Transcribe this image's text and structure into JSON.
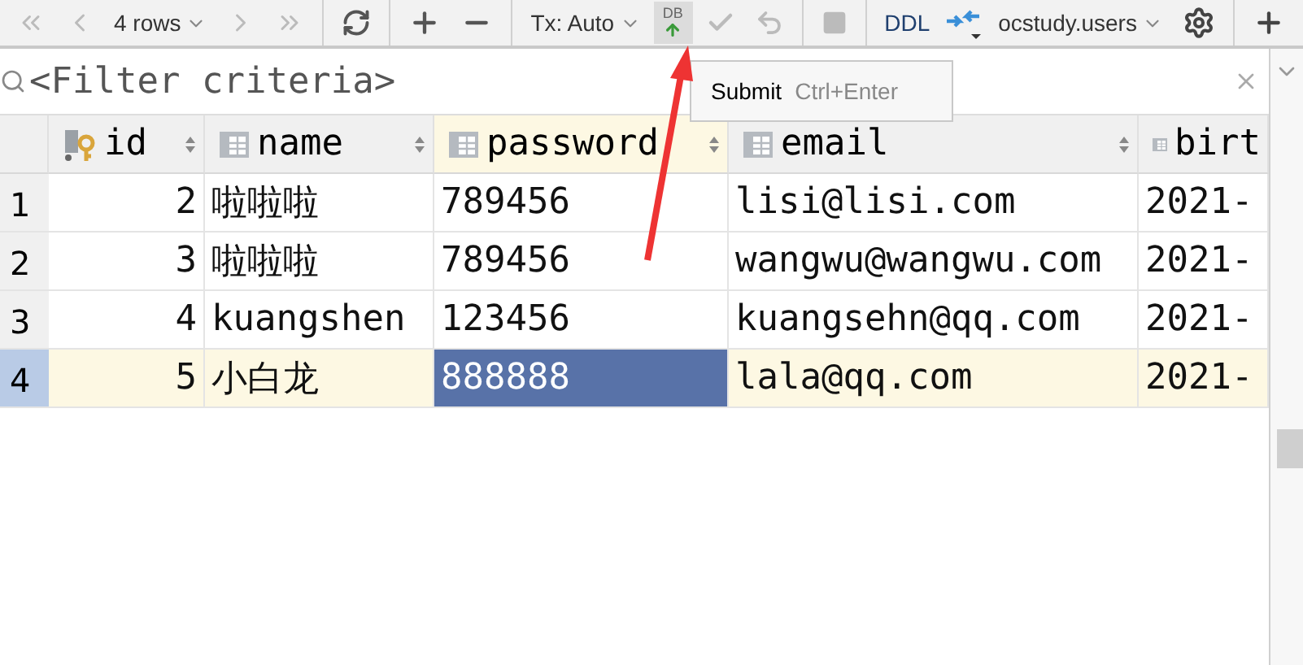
{
  "toolbar": {
    "rows_label": "4 rows",
    "tx_label": "Tx: Auto",
    "submit_label": "DB",
    "ddl_label": "DDL",
    "table_name": "ocstudy.users"
  },
  "tooltip": {
    "label": "Submit",
    "shortcut": "Ctrl+Enter"
  },
  "filter": {
    "placeholder": "<Filter criteria>"
  },
  "table": {
    "columns": [
      {
        "label": "id",
        "kind": "key",
        "selected": false
      },
      {
        "label": "name",
        "kind": "column",
        "selected": false
      },
      {
        "label": "password",
        "kind": "column",
        "selected": true
      },
      {
        "label": "email",
        "kind": "column",
        "selected": false
      },
      {
        "label": "birt",
        "kind": "column",
        "selected": false
      }
    ],
    "rows": [
      {
        "number": "1",
        "selected": false,
        "cells": [
          {
            "text": "2",
            "selected": false
          },
          {
            "text": "啦啦啦",
            "selected": false
          },
          {
            "text": "789456",
            "selected": false
          },
          {
            "text": "lisi@lisi.com",
            "selected": false
          },
          {
            "text": "2021-",
            "selected": false
          }
        ]
      },
      {
        "number": "2",
        "selected": false,
        "cells": [
          {
            "text": "3",
            "selected": false
          },
          {
            "text": "啦啦啦",
            "selected": false
          },
          {
            "text": "789456",
            "selected": false
          },
          {
            "text": "wangwu@wangwu.com",
            "selected": false
          },
          {
            "text": "2021-",
            "selected": false
          }
        ]
      },
      {
        "number": "3",
        "selected": false,
        "cells": [
          {
            "text": "4",
            "selected": false
          },
          {
            "text": "kuangshen",
            "selected": false
          },
          {
            "text": "123456",
            "selected": false
          },
          {
            "text": "kuangsehn@qq.com",
            "selected": false
          },
          {
            "text": "2021-",
            "selected": false
          }
        ]
      },
      {
        "number": "4",
        "selected": true,
        "cells": [
          {
            "text": "5",
            "selected": false
          },
          {
            "text": "小白龙",
            "selected": false
          },
          {
            "text": "888888",
            "selected": true
          },
          {
            "text": "lala@qq.com",
            "selected": false
          },
          {
            "text": "2021-",
            "selected": false
          }
        ]
      }
    ]
  }
}
